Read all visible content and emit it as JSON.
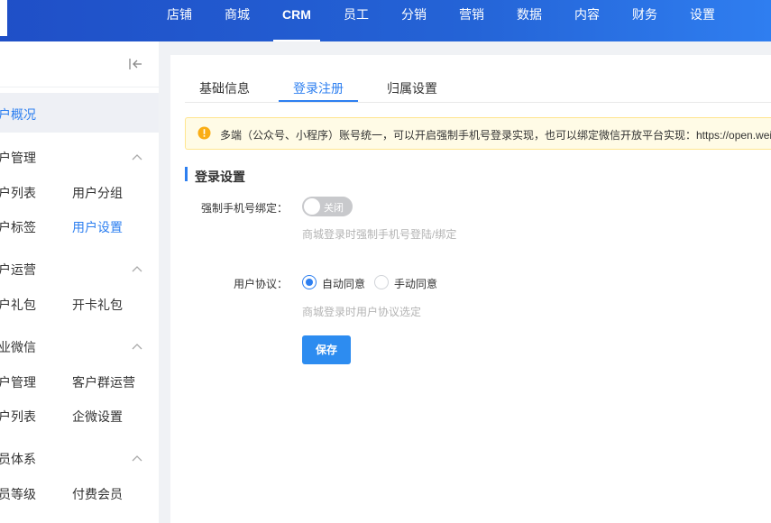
{
  "topnav": {
    "items": [
      {
        "label": "店铺"
      },
      {
        "label": "商城"
      },
      {
        "label": "CRM",
        "active": true
      },
      {
        "label": "员工"
      },
      {
        "label": "分销"
      },
      {
        "label": "营销"
      },
      {
        "label": "数据"
      },
      {
        "label": "内容"
      },
      {
        "label": "财务"
      },
      {
        "label": "设置"
      }
    ]
  },
  "sidebar": {
    "collapse_icon": "collapse-left-icon",
    "overview": "户概况",
    "groups": [
      {
        "heading": "户管理",
        "items": [
          "户列表",
          "用户分组",
          "户标签",
          "用户设置"
        ],
        "active_item": "用户设置"
      },
      {
        "heading": "户运营",
        "items": [
          "户礼包",
          "开卡礼包"
        ]
      },
      {
        "heading": "业微信",
        "items": [
          "户管理",
          "客户群运营",
          "户列表",
          "企微设置"
        ]
      },
      {
        "heading": "员体系",
        "items": [
          "员等级",
          "付费会员"
        ]
      }
    ]
  },
  "main": {
    "tabs": [
      {
        "label": "基础信息"
      },
      {
        "label": "登录注册",
        "active": true
      },
      {
        "label": "归属设置"
      }
    ],
    "notice": {
      "icon": "warning-icon",
      "text": "多端（公众号、小程序）账号统一，可以开启强制手机号登录实现，也可以绑定微信开放平台实现：https://open.weixin.qq.com/"
    },
    "section_title": "登录设置",
    "form": {
      "phone_binding": {
        "label": "强制手机号绑定：",
        "switch_text": "关闭",
        "enabled": false,
        "hint": "商城登录时强制手机号登陆/绑定"
      },
      "agreement": {
        "label": "用户协议：",
        "options": [
          "自动同意",
          "手动同意"
        ],
        "selected": "自动同意",
        "hint": "商城登录时用户协议选定"
      },
      "save_label": "保存"
    }
  },
  "colors": {
    "primary": "#2d7ff0",
    "topbar_start": "#1f4fc7",
    "topbar_end": "#2f7ef0",
    "notice_bg": "#fffbe6",
    "notice_icon": "#faad14"
  }
}
